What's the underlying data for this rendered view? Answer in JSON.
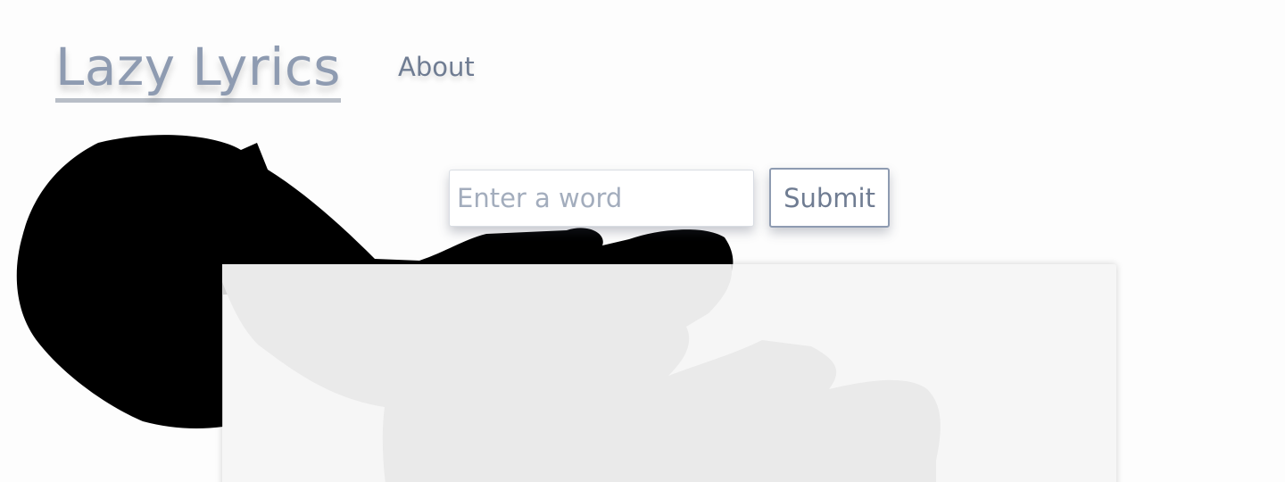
{
  "navbar": {
    "brand": "Lazy Lyrics",
    "about_label": "About"
  },
  "search": {
    "placeholder": "Enter a word",
    "value": "",
    "submit_label": "Submit"
  },
  "results": {
    "content": ""
  },
  "colors": {
    "brand_text": "#8e9bb1",
    "nav_text": "#6f7c92",
    "button_border": "#8e9bb1",
    "panel_background": "#f4f4f4",
    "silhouette": "#000000"
  }
}
